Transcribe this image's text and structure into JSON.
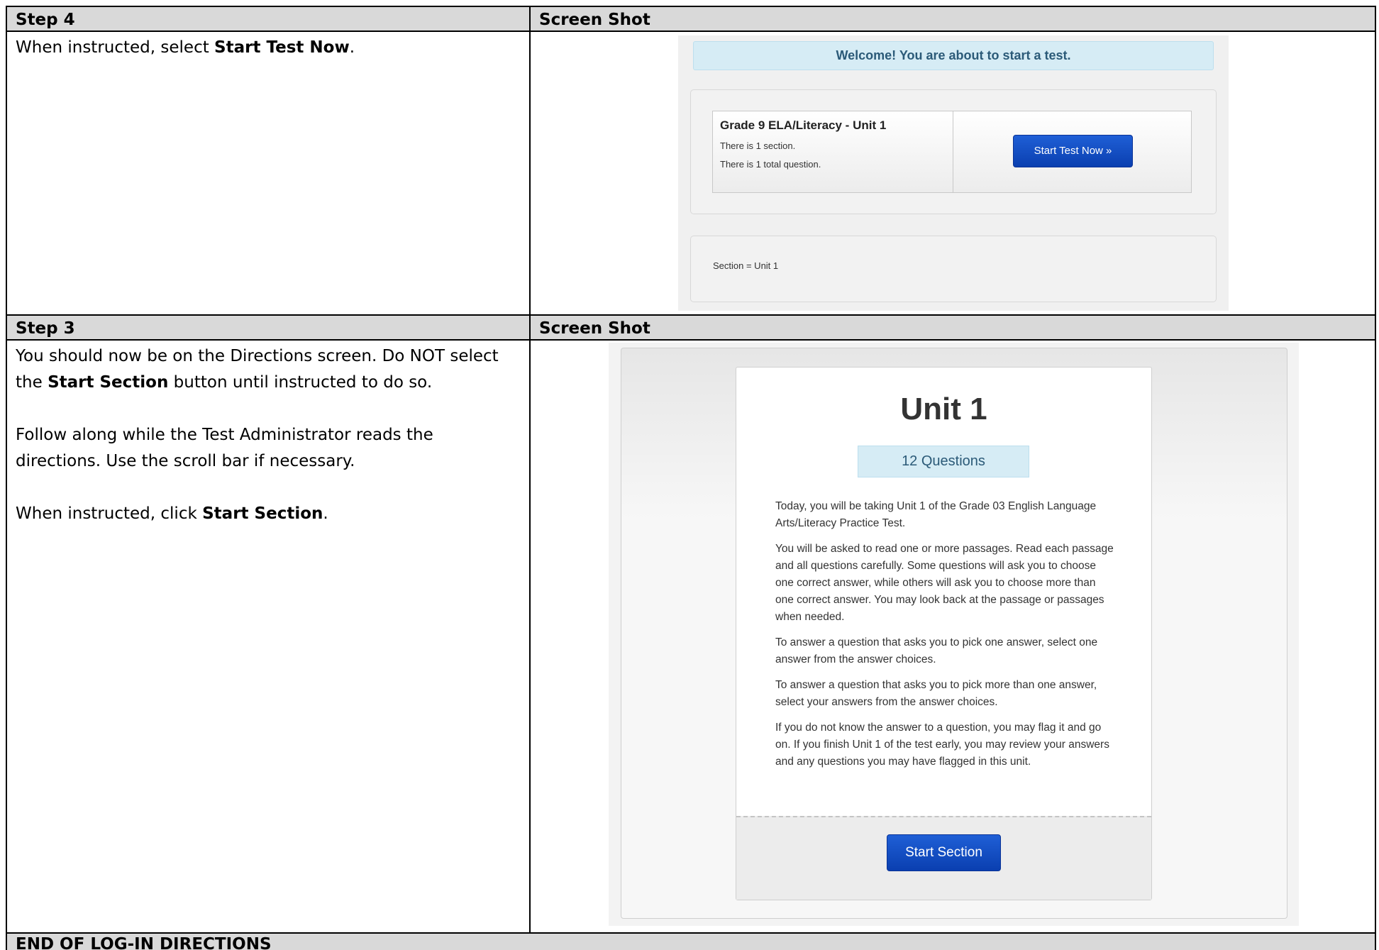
{
  "step4": {
    "header_left": "Step 4",
    "header_right": "Screen Shot",
    "text_prefix": "When instructed, select ",
    "text_bold": "Start Test Now",
    "text_suffix": "."
  },
  "step4_screenshot": {
    "welcome": "Welcome! You are about to start a test.",
    "test_name": "Grade 9 ELA/Literacy - Unit 1",
    "sections_line": "There is 1 section.",
    "questions_line": "There is 1 total question.",
    "start_button": "Start Test Now »",
    "section_label": "Section = Unit 1"
  },
  "step3": {
    "header_left": "Step 3",
    "header_right": "Screen Shot",
    "p1_prefix": "You should now be on the Directions screen. Do NOT select the ",
    "p1_bold": "Start Section",
    "p1_suffix": " button until instructed to do so.",
    "p2": "Follow along while the Test Administrator reads the directions. Use the scroll bar if necessary.",
    "p3_prefix": "When instructed, click ",
    "p3_bold": "Start Section",
    "p3_suffix": "."
  },
  "step3_screenshot": {
    "unit_title": "Unit 1",
    "question_count": "12 Questions",
    "paragraphs": [
      "Today, you will be taking Unit 1 of the Grade 03 English Language Arts/Literacy Practice Test.",
      "You will be asked to read one or more passages. Read each passage and all questions carefully. Some questions will ask you to choose one correct answer, while others will ask you to choose more than one correct answer. You may look back at the passage or passages when needed.",
      "To answer a question that asks you to pick one answer, select one answer from the answer choices.",
      "To answer a question that asks you to pick more than one answer, select your answers from the answer choices.",
      "If you do not know the answer to a question, you may flag it and go on. If you finish Unit 1 of the test early, you may review your answers and any questions you may have flagged in this unit."
    ],
    "start_button": "Start Section"
  },
  "footer": {
    "text": "END OF LOG-IN DIRECTIONS"
  }
}
